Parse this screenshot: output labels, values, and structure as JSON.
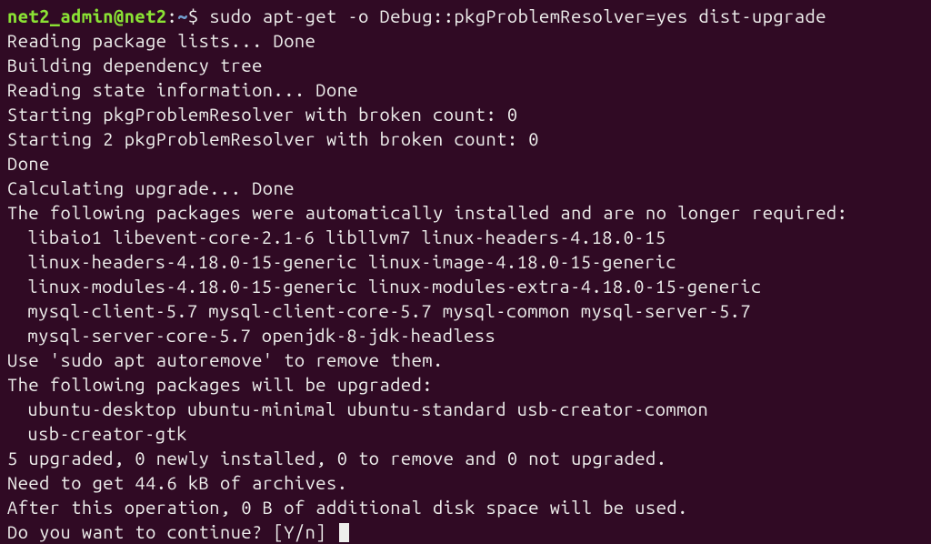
{
  "prompt": {
    "user": "net2_admin",
    "host": "net2",
    "path": "~",
    "symbol": "$"
  },
  "command": "sudo apt-get -o Debug::pkgProblemResolver=yes  dist-upgrade",
  "lines": [
    "Reading package lists... Done",
    "Building dependency tree",
    "Reading state information... Done",
    "Starting pkgProblemResolver with broken count: 0",
    "Starting 2 pkgProblemResolver with broken count: 0",
    "Done",
    "Calculating upgrade... Done",
    "The following packages were automatically installed and are no longer required:"
  ],
  "not_required": [
    "libaio1 libevent-core-2.1-6 libllvm7 linux-headers-4.18.0-15",
    "linux-headers-4.18.0-15-generic linux-image-4.18.0-15-generic",
    "linux-modules-4.18.0-15-generic linux-modules-extra-4.18.0-15-generic",
    "mysql-client-5.7 mysql-client-core-5.7 mysql-common mysql-server-5.7",
    "mysql-server-core-5.7 openjdk-8-jdk-headless"
  ],
  "mid_lines": [
    "Use 'sudo apt autoremove' to remove them.",
    "The following packages will be upgraded:"
  ],
  "upgraded": [
    "ubuntu-desktop ubuntu-minimal ubuntu-standard usb-creator-common",
    "usb-creator-gtk"
  ],
  "summary": [
    "5 upgraded, 0 newly installed, 0 to remove and 0 not upgraded.",
    "Need to get 44.6 kB of archives.",
    "After this operation, 0 B of additional disk space will be used."
  ],
  "continue_prompt": "Do you want to continue? [Y/n] "
}
